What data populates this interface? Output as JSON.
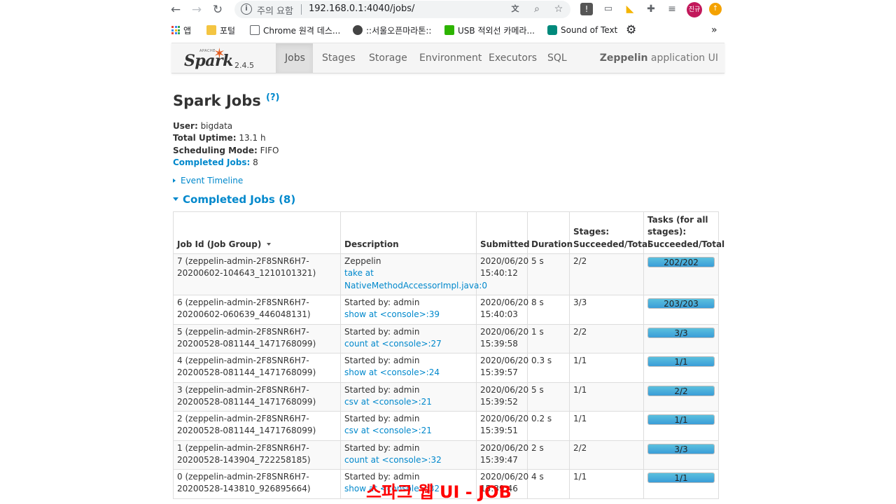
{
  "browser": {
    "security_label": "주의 요함",
    "url": "192.168.0.1:4040/jobs/",
    "profile_label": "진규",
    "bookmarks": [
      {
        "label": "앱"
      },
      {
        "label": "포털"
      },
      {
        "label": "Chrome 원격 데스..."
      },
      {
        "label": "::서울오픈마라톤::"
      },
      {
        "label": "USB 적외선 카메라..."
      },
      {
        "label": "Sound of Text"
      }
    ],
    "bookmarks_overflow": "»"
  },
  "spark": {
    "logo_text": "Spark",
    "apache_text": "APACHE",
    "version": "2.4.5",
    "tabs": [
      {
        "label": "Jobs",
        "active": true
      },
      {
        "label": "Stages",
        "active": false
      },
      {
        "label": "Storage",
        "active": false
      },
      {
        "label": "Environment",
        "active": false
      },
      {
        "label": "Executors",
        "active": false
      },
      {
        "label": "SQL",
        "active": false
      }
    ],
    "app_name_bold": "Zeppelin",
    "app_name_suffix": " application UI"
  },
  "page": {
    "title": "Spark Jobs",
    "help": "(?)",
    "info": {
      "user_label": "User:",
      "user_value": " bigdata",
      "uptime_label": "Total Uptime:",
      "uptime_value": " 13.1 h",
      "mode_label": "Scheduling Mode:",
      "mode_value": " FIFO",
      "completed_label": "Completed Jobs:",
      "completed_value": " 8"
    },
    "event_timeline": "Event Timeline",
    "completed_section": "Completed Jobs (8)"
  },
  "table": {
    "headers": {
      "job_id": "Job Id (Job Group)",
      "description": "Description",
      "submitted": "Submitted",
      "duration": "Duration",
      "stages": "Stages: Succeeded/Total",
      "tasks": "Tasks (for all stages): Succeeded/Total"
    },
    "rows": [
      {
        "job": "7 (zeppelin-admin-2F8SNR6H7-20200602-104643_1210101321)",
        "desc_top": "Zeppelin",
        "desc_link": "take at NativeMethodAccessorImpl.java:0",
        "submitted": "2020/06/20 15:40:12",
        "duration": "5 s",
        "stages": "2/2",
        "tasks": "202/202",
        "progress": 1.0
      },
      {
        "job": "6 (zeppelin-admin-2F8SNR6H7-20200602-060639_446048131)",
        "desc_top": "Started by: admin",
        "desc_link": "show at <console>:39",
        "submitted": "2020/06/20 15:40:03",
        "duration": "8 s",
        "stages": "3/3",
        "tasks": "203/203",
        "progress": 1.0
      },
      {
        "job": "5 (zeppelin-admin-2F8SNR6H7-20200528-081144_1471768099)",
        "desc_top": "Started by: admin",
        "desc_link": "count at <console>:27",
        "submitted": "2020/06/20 15:39:58",
        "duration": "1 s",
        "stages": "2/2",
        "tasks": "3/3",
        "progress": 1.0
      },
      {
        "job": "4 (zeppelin-admin-2F8SNR6H7-20200528-081144_1471768099)",
        "desc_top": "Started by: admin",
        "desc_link": "show at <console>:24",
        "submitted": "2020/06/20 15:39:57",
        "duration": "0.3 s",
        "stages": "1/1",
        "tasks": "1/1",
        "progress": 1.0
      },
      {
        "job": "3 (zeppelin-admin-2F8SNR6H7-20200528-081144_1471768099)",
        "desc_top": "Started by: admin",
        "desc_link": "csv at <console>:21",
        "submitted": "2020/06/20 15:39:52",
        "duration": "5 s",
        "stages": "1/1",
        "tasks": "2/2",
        "progress": 1.0
      },
      {
        "job": "2 (zeppelin-admin-2F8SNR6H7-20200528-081144_1471768099)",
        "desc_top": "Started by: admin",
        "desc_link": "csv at <console>:21",
        "submitted": "2020/06/20 15:39:51",
        "duration": "0.2 s",
        "stages": "1/1",
        "tasks": "1/1",
        "progress": 1.0
      },
      {
        "job": "1 (zeppelin-admin-2F8SNR6H7-20200528-143904_722258185)",
        "desc_top": "Started by: admin",
        "desc_link": "count at <console>:32",
        "submitted": "2020/06/20 15:39:47",
        "duration": "2 s",
        "stages": "2/2",
        "tasks": "3/3",
        "progress": 1.0
      },
      {
        "job": "0 (zeppelin-admin-2F8SNR6H7-20200528-143810_926895664)",
        "desc_top": "Started by: admin",
        "desc_link": "show at <console>:32",
        "submitted": "2020/06/20 15:39:46",
        "duration": "4 s",
        "stages": "1/1",
        "tasks": "1/1",
        "progress": 1.0
      }
    ]
  },
  "caption": "스파크 웹 UI - JOB",
  "colors": {
    "link": "#0088cc",
    "progress": "#3a9dd8",
    "caption": "#ff0000",
    "spark_star": "#e25a1c"
  }
}
